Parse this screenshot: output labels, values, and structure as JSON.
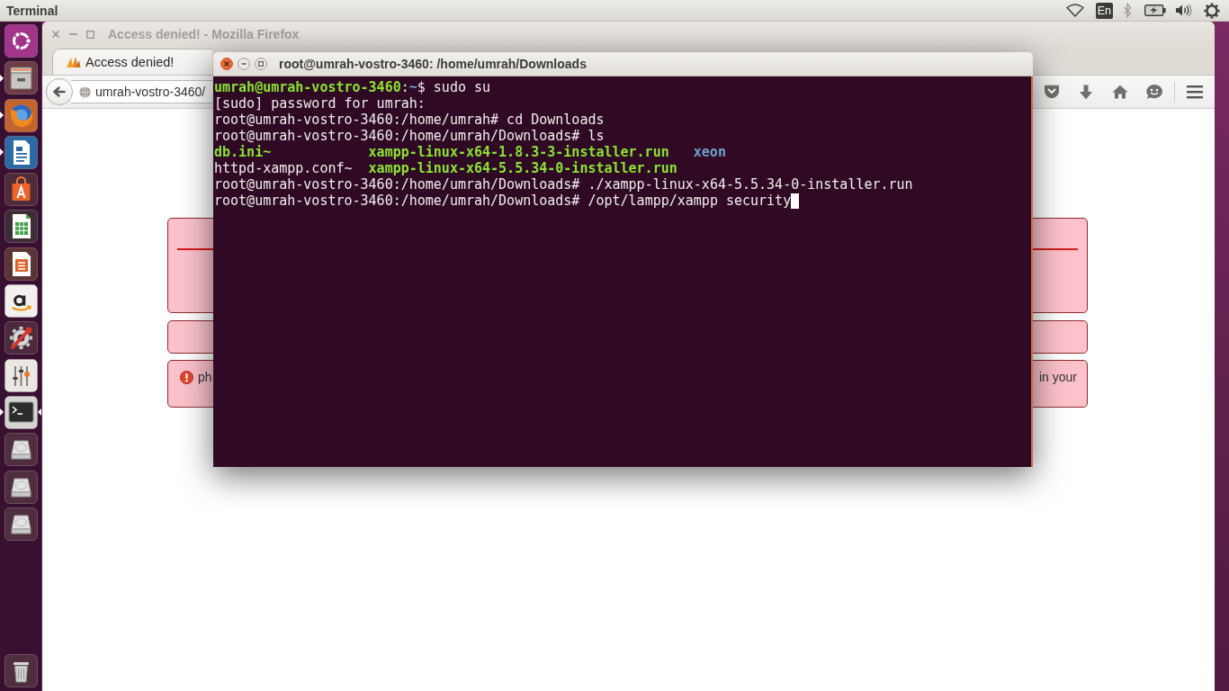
{
  "top_panel": {
    "app_name": "Terminal",
    "keyboard_layout": "En"
  },
  "launcher": {
    "items": [
      {
        "kind": "dash",
        "running": false,
        "focused": false
      },
      {
        "kind": "files",
        "running": true,
        "focused": false
      },
      {
        "kind": "browser",
        "running": true,
        "focused": false
      },
      {
        "kind": "writer",
        "running": true,
        "focused": false
      },
      {
        "kind": "store",
        "running": false,
        "focused": false
      },
      {
        "kind": "spreadsheet",
        "running": false,
        "focused": false
      },
      {
        "kind": "presentation",
        "running": false,
        "focused": false
      },
      {
        "kind": "shop",
        "running": false,
        "focused": false
      },
      {
        "kind": "settings",
        "running": false,
        "focused": false
      },
      {
        "kind": "mixer",
        "running": false,
        "focused": false
      },
      {
        "kind": "terminal",
        "running": true,
        "focused": true
      },
      {
        "kind": "drive",
        "running": false,
        "focused": false
      },
      {
        "kind": "drive",
        "running": false,
        "focused": false
      },
      {
        "kind": "drive",
        "running": false,
        "focused": false
      }
    ],
    "bottom_items": [
      {
        "kind": "trash",
        "running": false,
        "focused": false
      }
    ]
  },
  "browser_window": {
    "title": "Access denied! - Mozilla Firefox",
    "active": false,
    "tabs": [
      {
        "label": "Access denied!",
        "selected": true
      }
    ],
    "address": "umrah-vostro-3460/",
    "panels": [
      {
        "kind": "heading"
      },
      {
        "kind": "blank"
      },
      {
        "kind": "error",
        "fragments": [
          "ph",
          "in your"
        ]
      }
    ]
  },
  "terminal_window": {
    "title": "root@umrah-vostro-3460: /home/umrah/Downloads",
    "active": true,
    "lines": [
      {
        "kind": "text",
        "cursor": false,
        "segments": [
          {
            "kind": "user",
            "text": "umrah@umrah-vostro-3460"
          },
          {
            "kind": "plain",
            "text": ":"
          },
          {
            "kind": "dir",
            "text": "~"
          },
          {
            "kind": "plain",
            "text": "$ sudo su"
          }
        ]
      },
      {
        "kind": "text",
        "cursor": false,
        "segments": [
          {
            "kind": "plain",
            "text": "[sudo] password for umrah:"
          }
        ]
      },
      {
        "kind": "text",
        "cursor": false,
        "segments": [
          {
            "kind": "plain",
            "text": "root@umrah-vostro-3460:/home/umrah# cd Downloads"
          }
        ]
      },
      {
        "kind": "text",
        "cursor": false,
        "segments": [
          {
            "kind": "plain",
            "text": "root@umrah-vostro-3460:/home/umrah/Downloads# ls"
          }
        ]
      },
      {
        "kind": "listing",
        "cursor": false,
        "entries": [
          {
            "kind": "exec",
            "text": "db.ini~"
          },
          {
            "kind": "exec",
            "text": "xampp-linux-x64-1.8.3-3-installer.run"
          },
          {
            "kind": "dir",
            "text": "xeon"
          }
        ]
      },
      {
        "kind": "listing",
        "cursor": false,
        "entries": [
          {
            "kind": "plain",
            "text": "httpd-xampp.conf~"
          },
          {
            "kind": "exec",
            "text": "xampp-linux-x64-5.5.34-0-installer.run"
          }
        ]
      },
      {
        "kind": "text",
        "cursor": false,
        "segments": [
          {
            "kind": "plain",
            "text": "root@umrah-vostro-3460:/home/umrah/Downloads# ./xampp-linux-x64-5.5.34-0-installer.run"
          }
        ]
      },
      {
        "kind": "text",
        "cursor": true,
        "segments": [
          {
            "kind": "plain",
            "text": "root@umrah-vostro-3460:/home/umrah/Downloads# /opt/lampp/xampp security"
          }
        ]
      }
    ]
  }
}
